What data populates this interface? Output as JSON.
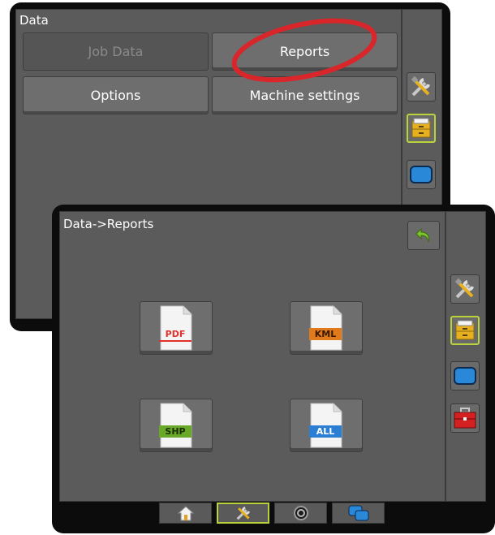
{
  "back_screen": {
    "title": "Data",
    "buttons": {
      "job_data": "Job Data",
      "reports": "Reports",
      "options": "Options",
      "machine_settings": "Machine settings"
    }
  },
  "front_screen": {
    "title": "Data->Reports",
    "files": {
      "pdf": "PDF",
      "kml": "KML",
      "shp": "SHP",
      "all": "ALL"
    }
  },
  "colors": {
    "highlight_ring": "#d9262a",
    "active_border": "#b8d43a",
    "pdf": "#e0312b",
    "kml": "#e07a1a",
    "shp": "#6aa82a",
    "all": "#2a7fd4"
  },
  "icons": {
    "tools": "tools-icon",
    "data": "file-cabinet-icon",
    "display": "display-icon",
    "toolbox": "toolbox-icon",
    "back": "back-arrow-icon",
    "home": "home-icon",
    "guidance": "guidance-icon",
    "screens": "screens-icon"
  }
}
